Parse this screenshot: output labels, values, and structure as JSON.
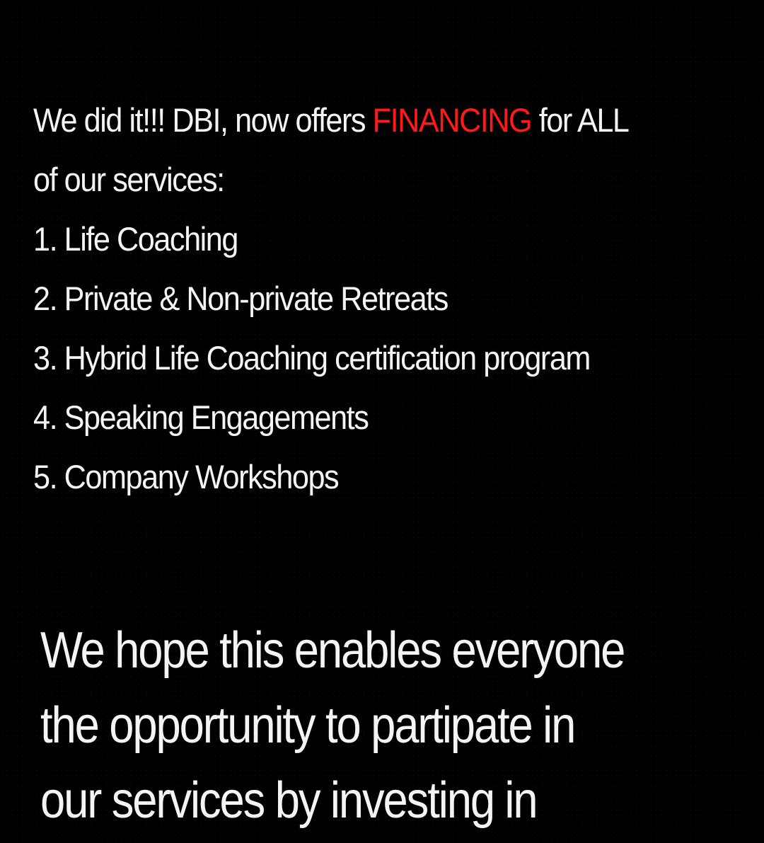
{
  "colors": {
    "background": "#000000",
    "text": "#f4f4f4",
    "accent": "#ff1a1a"
  },
  "headline": {
    "line1_before": "We did it!!! DBI, now offers ",
    "line1_highlight": "FINANCING",
    "line1_after": " for ALL",
    "line2": "of our services:"
  },
  "services": [
    "1. Life Coaching",
    "2. Private & Non-private Retreats",
    "3. Hybrid Life Coaching certification program",
    "4. Speaking Engagements",
    "5. Company Workshops"
  ],
  "closing": {
    "lines": [
      "We hope this enables everyone",
      "the opportunity to partipate in",
      "our services by investing in"
    ]
  }
}
